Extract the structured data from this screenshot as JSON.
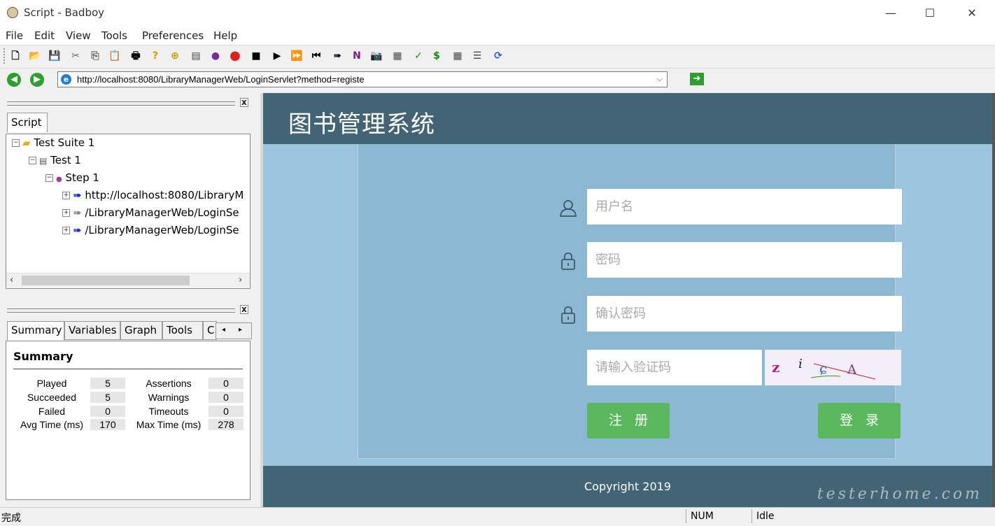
{
  "window": {
    "title": "Script - Badboy",
    "minimize": "—",
    "maximize": "☐",
    "close": "✕"
  },
  "menu": [
    "File",
    "Edit",
    "View",
    "Tools",
    "Preferences",
    "Help"
  ],
  "toolbar_icons": [
    "new-icon",
    "open-icon",
    "save-icon",
    "cut-icon",
    "copy-icon",
    "paste-icon",
    "print-icon",
    "help-icon",
    "add-suite-icon",
    "add-test-icon",
    "add-step-icon",
    "record-icon",
    "stop-icon",
    "play-icon",
    "play-all-icon",
    "rewind-icon",
    "step-forward-icon",
    "navigation-icon",
    "screenshot-icon",
    "report-icon",
    "assertion-icon",
    "variable-icon",
    "table-icon",
    "tree-icon",
    "refresh-icon"
  ],
  "address": {
    "url": "http://localhost:8080/LibraryManagerWeb/LoginServlet?method=registe"
  },
  "script_pane": {
    "tab": "Script",
    "tree": [
      {
        "label": "Test Suite 1",
        "icon": "folder-icon"
      },
      {
        "label": "Test 1",
        "icon": "test-icon"
      },
      {
        "label": "Step 1",
        "icon": "step-icon"
      },
      {
        "label": "http://localhost:8080/LibraryM",
        "icon": "request-icon"
      },
      {
        "label": "/LibraryManagerWeb/LoginSe",
        "icon": "request-icon"
      },
      {
        "label": "/LibraryManagerWeb/LoginSe",
        "icon": "request-icon"
      }
    ]
  },
  "summary_pane": {
    "tabs": [
      "Summary",
      "Variables",
      "Graph",
      "Tools",
      "C"
    ],
    "title": "Summary",
    "stats": {
      "played_label": "Played",
      "played": "5",
      "succeeded_label": "Succeeded",
      "succeeded": "5",
      "failed_label": "Failed",
      "failed": "0",
      "avg_label": "Avg Time (ms)",
      "avg": "170",
      "assertions_label": "Assertions",
      "assertions": "0",
      "warnings_label": "Warnings",
      "warnings": "0",
      "timeouts_label": "Timeouts",
      "timeouts": "0",
      "max_label": "Max Time (ms)",
      "max": "278"
    }
  },
  "web": {
    "title": "图书管理系统",
    "username_placeholder": "用户名",
    "password_placeholder": "密码",
    "confirm_placeholder": "确认密码",
    "captcha_placeholder": "请输入验证码",
    "register_label": "注册",
    "login_label": "登录",
    "copyright": "Copyright  2019",
    "watermark": "testerhome.com",
    "colors": {
      "header": "#436474",
      "body": "#9ec5e0",
      "button": "#5cb85c"
    }
  },
  "status": {
    "main": "完成",
    "num": "NUM",
    "state": "Idle"
  }
}
